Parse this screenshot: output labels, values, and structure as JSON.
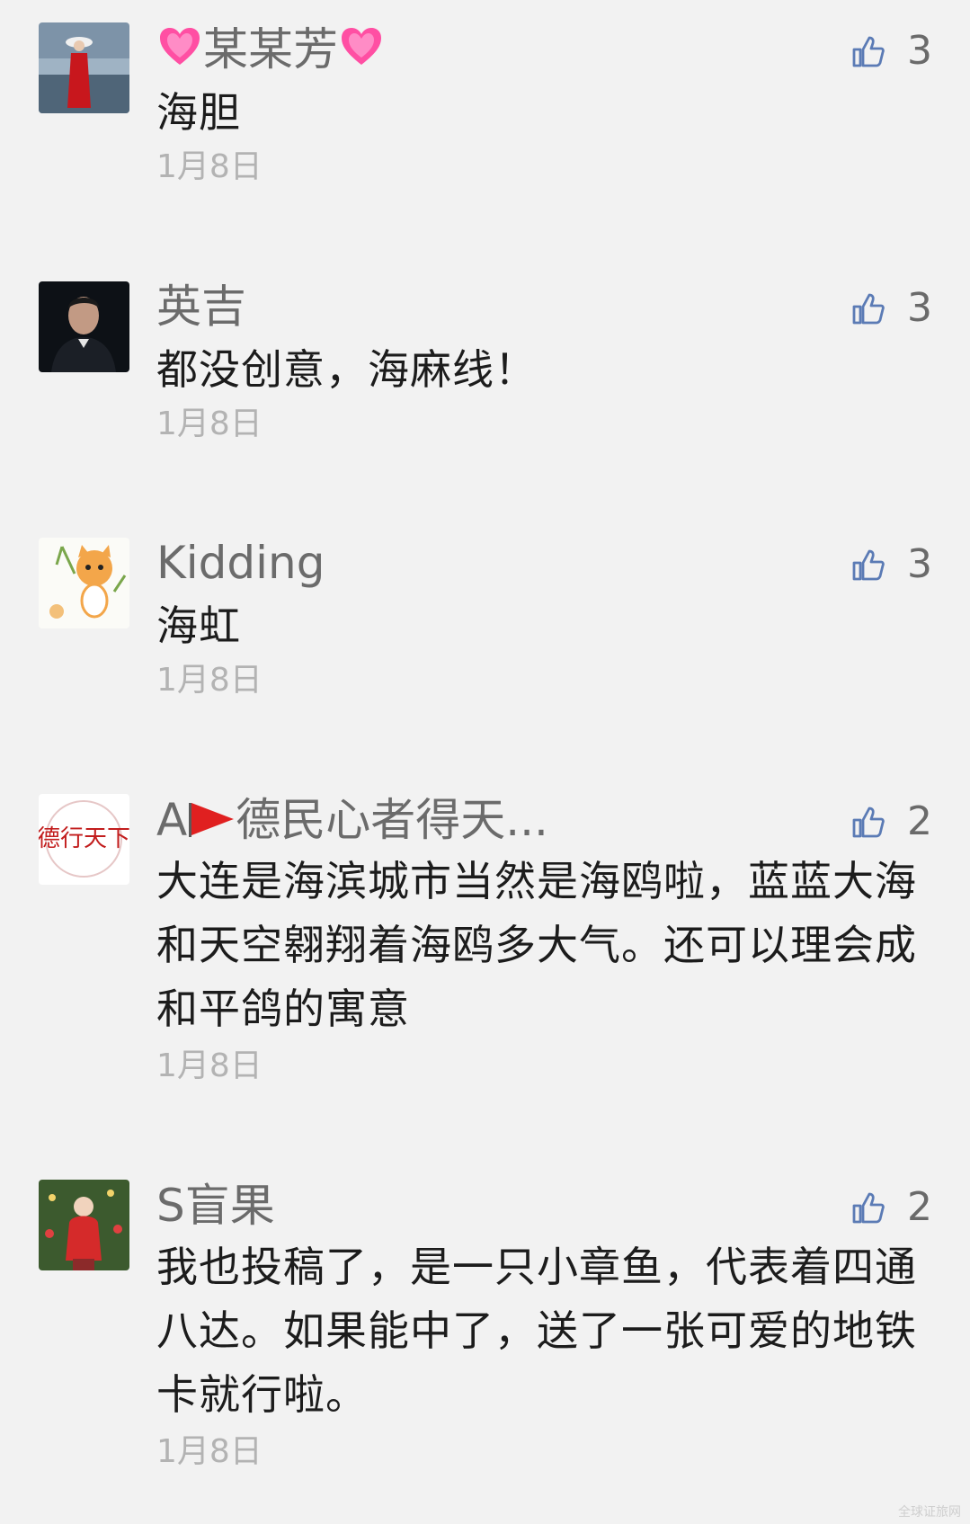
{
  "comments": [
    {
      "name_prefix": "",
      "name": "某某芳",
      "body": "海胆",
      "date": "1月8日",
      "likes": "3",
      "avatar": "woman-red-dress-avatar"
    },
    {
      "name_prefix": "",
      "name": "英吉",
      "body": "都没创意，海麻线！",
      "date": "1月8日",
      "likes": "3",
      "avatar": "man-portrait-avatar"
    },
    {
      "name_prefix": "",
      "name": "Kidding",
      "body": "海虹",
      "date": "1月8日",
      "likes": "3",
      "avatar": "cartoon-cat-avatar"
    },
    {
      "name_prefix": "A",
      "name": "德民心者得天...",
      "body": "大连是海滨城市当然是海鸥啦，蓝蓝大海和天空翱翔着海鸥多大气。还可以理会成和平鸽的寓意",
      "date": "1月8日",
      "likes": "2",
      "avatar": "calligraphy-seal-avatar",
      "avatar_text": "德行天下"
    },
    {
      "name_prefix": "",
      "name": "S盲果",
      "body": "我也投稿了，是一只小章鱼，代表着四通八达。如果能中了，送了一张可爱的地铁卡就行啦。",
      "date": "1月8日",
      "likes": "2",
      "avatar": "christmas-child-avatar"
    }
  ],
  "icons": {
    "like": "thumbs-up-icon",
    "heart": "pink-heart-icon",
    "flag": "red-flag-icon"
  },
  "colors": {
    "like_icon": "#5b7bb5",
    "heart": "#ff4fa3",
    "flag": "#e02020"
  },
  "watermark": "全球证旅网"
}
